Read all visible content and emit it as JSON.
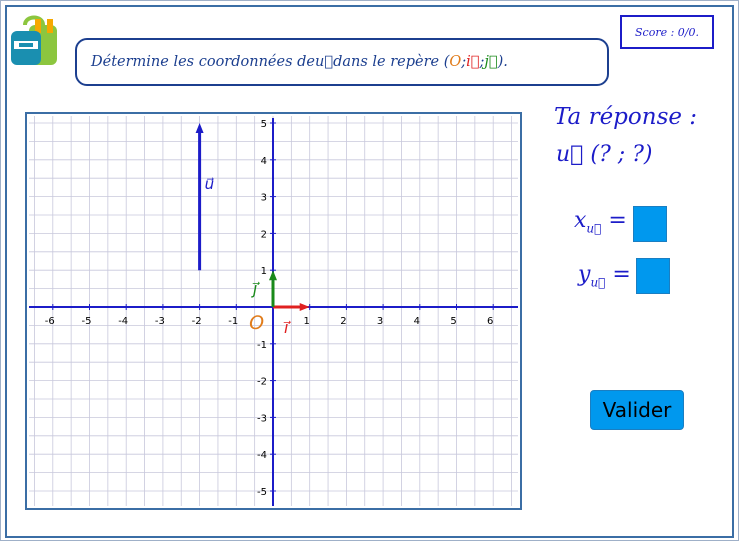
{
  "score": {
    "label": "Score : 0/0."
  },
  "instruction": {
    "prefix": "Détermine les coordonnées de ",
    "vector": "u⃗",
    "middle": " dans le repère ( ",
    "origin": "O",
    "sep1": " ; ",
    "i": "i⃗",
    "sep2": " ; ",
    "j": "j⃗",
    "suffix": " )."
  },
  "answer": {
    "title": "Ta réponse :",
    "template": "u⃗ (? ; ?)",
    "x_label": "x",
    "x_sub": "u⃗",
    "y_label": "y",
    "y_sub": "u⃗",
    "equals": "=",
    "validate_label": "Valider"
  },
  "graph": {
    "x_ticks": [
      "-6",
      "-5",
      "-4",
      "-3",
      "-2",
      "-1",
      "1",
      "2",
      "3",
      "4",
      "5",
      "6"
    ],
    "y_ticks": [
      "5",
      "4",
      "3",
      "2",
      "1",
      "-1",
      "-2",
      "-3",
      "-4",
      "-5"
    ],
    "origin_label": "O",
    "i_label": "i⃗",
    "j_label": "j⃗",
    "u_label": "u⃗",
    "vector_u": {
      "from": [
        -2,
        1
      ],
      "to": [
        -2,
        5
      ]
    },
    "vector_i": {
      "from": [
        0,
        0
      ],
      "to": [
        1,
        0
      ]
    },
    "vector_j": {
      "from": [
        0,
        0
      ],
      "to": [
        0,
        1
      ]
    },
    "colors": {
      "axis": "#1c1cc8",
      "grid": "#c8c8dc",
      "i": "#e02020",
      "j": "#1a8a1a",
      "origin": "#e07b1a",
      "u": "#1c1cc8"
    }
  }
}
